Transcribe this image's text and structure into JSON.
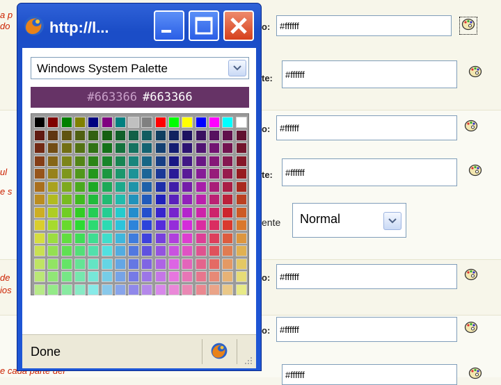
{
  "background_form": {
    "left_notes": [
      "a p",
      "do",
      "ul",
      "e s",
      "de",
      "ios",
      "e cada parte del"
    ],
    "rows": [
      {
        "label": "o:",
        "value": "#ffffff"
      },
      {
        "label": "te:",
        "value": "#ffffff"
      },
      {
        "label": "o:",
        "value": "#ffffff"
      },
      {
        "label": "te:",
        "value": "#ffffff"
      },
      {
        "label": "o:",
        "value": "#ffffff"
      },
      {
        "label": "o:",
        "value": "#ffffff"
      },
      {
        "label": "",
        "value": "#ffffff"
      }
    ],
    "font_style_label": "ente",
    "font_style_value": "Normal"
  },
  "popup": {
    "title": "http://l...",
    "palette_select_value": "Windows System Palette",
    "preview_hex_dark": "#663366",
    "preview_hex_light": "#663366",
    "preview_color": "#663366",
    "status_text": "Done",
    "swatches": [
      [
        "#000000",
        "#800000",
        "#008000",
        "#808000",
        "#000080",
        "#800080",
        "#008080",
        "#c0c0c0",
        "#808080",
        "#ff0000",
        "#00ff00",
        "#ffff00",
        "#0000ff",
        "#ff00ff",
        "#00ffff",
        "#ffffff"
      ]
    ]
  },
  "colors": {
    "window_blue": "#1e56d6",
    "close_red": "#d6401c",
    "note_red": "#cc2200"
  }
}
